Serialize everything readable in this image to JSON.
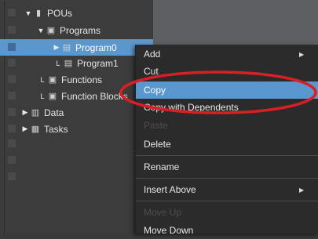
{
  "tree": {
    "items": [
      {
        "label": "POUs",
        "toggle": "▼",
        "icon": "clipboard-icon"
      },
      {
        "label": "Programs",
        "toggle": "▼",
        "icon": "folder-icon"
      },
      {
        "label": "Program0",
        "toggle": "▶",
        "icon": "program-icon"
      },
      {
        "label": "Program1",
        "toggle": "L",
        "icon": "program-icon"
      },
      {
        "label": "Functions",
        "toggle": "L",
        "icon": "folder-icon"
      },
      {
        "label": "Function Blocks",
        "toggle": "L",
        "icon": "folder-icon"
      },
      {
        "label": "Data",
        "toggle": "▶",
        "icon": "table-icon"
      },
      {
        "label": "Tasks",
        "toggle": "▶",
        "icon": "tasks-icon"
      }
    ],
    "selected": "Program0"
  },
  "context_menu": {
    "items": [
      {
        "label": "Add",
        "submenu": true
      },
      {
        "label": "Cut"
      },
      {
        "label": "Copy",
        "highlighted": true
      },
      {
        "label": "Copy with Dependents"
      },
      {
        "label": "Paste",
        "disabled": true
      },
      {
        "label": "Delete"
      },
      {
        "label": "Rename"
      },
      {
        "label": "Insert Above",
        "submenu": true
      },
      {
        "label": "Move Up",
        "disabled": true
      },
      {
        "label": "Move Down"
      }
    ]
  },
  "annotation": {
    "color": "#d81f26"
  }
}
